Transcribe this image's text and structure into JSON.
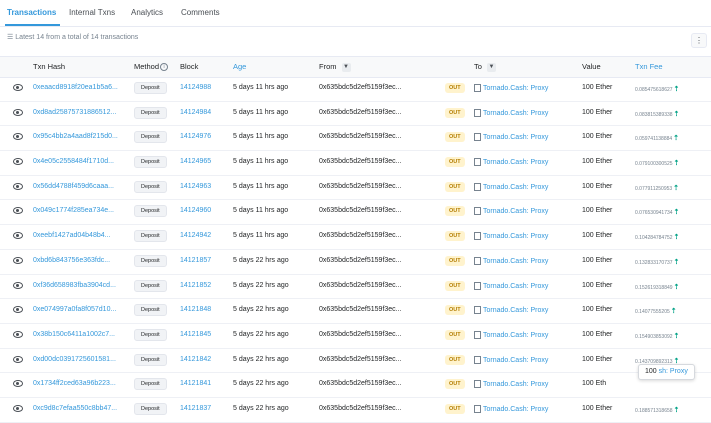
{
  "tabs": [
    {
      "label": "Transactions"
    },
    {
      "label": "Internal Txns"
    },
    {
      "label": "Analytics"
    },
    {
      "label": "Comments"
    }
  ],
  "summary": "Latest 14 from a total of 14 transactions",
  "menu_icon": "⋮",
  "columns": {
    "txn_hash": "Txn Hash",
    "method": "Method",
    "block": "Block",
    "age": "Age",
    "from": "From",
    "to": "To",
    "value": "Value",
    "txn_fee": "Txn Fee"
  },
  "colors": {
    "accent": "#3498db",
    "out_badge_bg": "#fff3cd",
    "out_badge_text": "#b47d00",
    "fee_up": "#00a186"
  },
  "rows": [
    {
      "hash": "0xeaacd8918f20ea1b5a6...",
      "method": "Deposit",
      "block": "14124988",
      "age": "5 days 11 hrs ago",
      "from": "0x635bdc5d2ef5159f3ec...",
      "dir": "OUT",
      "to": "Tornado.Cash: Proxy",
      "value": "100 Ether",
      "fee": "0.085475618627"
    },
    {
      "hash": "0xd8ad25875731886512...",
      "method": "Deposit",
      "block": "14124984",
      "age": "5 days 11 hrs ago",
      "from": "0x635bdc5d2ef5159f3ec...",
      "dir": "OUT",
      "to": "Tornado.Cash: Proxy",
      "value": "100 Ether",
      "fee": "0.083815389338"
    },
    {
      "hash": "0x95c4bb2a4aad8f215d0...",
      "method": "Deposit",
      "block": "14124976",
      "age": "5 days 11 hrs ago",
      "from": "0x635bdc5d2ef5159f3ec...",
      "dir": "OUT",
      "to": "Tornado.Cash: Proxy",
      "value": "100 Ether",
      "fee": "0.059741138884"
    },
    {
      "hash": "0x4e05c2558484f1710d...",
      "method": "Deposit",
      "block": "14124965",
      "age": "5 days 11 hrs ago",
      "from": "0x635bdc5d2ef5159f3ec...",
      "dir": "OUT",
      "to": "Tornado.Cash: Proxy",
      "value": "100 Ether",
      "fee": "0.079100300525"
    },
    {
      "hash": "0x56dd4788f459d6caaa...",
      "method": "Deposit",
      "block": "14124963",
      "age": "5 days 11 hrs ago",
      "from": "0x635bdc5d2ef5159f3ec...",
      "dir": "OUT",
      "to": "Tornado.Cash: Proxy",
      "value": "100 Ether",
      "fee": "0.077911250953"
    },
    {
      "hash": "0x049c1774f285ea734e...",
      "method": "Deposit",
      "block": "14124960",
      "age": "5 days 11 hrs ago",
      "from": "0x635bdc5d2ef5159f3ec...",
      "dir": "OUT",
      "to": "Tornado.Cash: Proxy",
      "value": "100 Ether",
      "fee": "0.076530941734"
    },
    {
      "hash": "0xeebf1427ad04b48b4...",
      "method": "Deposit",
      "block": "14124942",
      "age": "5 days 11 hrs ago",
      "from": "0x635bdc5d2ef5159f3ec...",
      "dir": "OUT",
      "to": "Tornado.Cash: Proxy",
      "value": "100 Ether",
      "fee": "0.104284784752"
    },
    {
      "hash": "0xbd6b843756e363fdc...",
      "method": "Deposit",
      "block": "14121857",
      "age": "5 days 22 hrs ago",
      "from": "0x635bdc5d2ef5159f3ec...",
      "dir": "OUT",
      "to": "Tornado.Cash: Proxy",
      "value": "100 Ether",
      "fee": "0.132833170737"
    },
    {
      "hash": "0xf36d658983fba3904cd...",
      "method": "Deposit",
      "block": "14121852",
      "age": "5 days 22 hrs ago",
      "from": "0x635bdc5d2ef5159f3ec...",
      "dir": "OUT",
      "to": "Tornado.Cash: Proxy",
      "value": "100 Ether",
      "fee": "0.152619318849"
    },
    {
      "hash": "0xe074997a0fa8f057d10...",
      "method": "Deposit",
      "block": "14121848",
      "age": "5 days 22 hrs ago",
      "from": "0x635bdc5d2ef5159f3ec...",
      "dir": "OUT",
      "to": "Tornado.Cash: Proxy",
      "value": "100 Ether",
      "fee": "0.14077555205"
    },
    {
      "hash": "0x38b150c6411a1002c7...",
      "method": "Deposit",
      "block": "14121845",
      "age": "5 days 22 hrs ago",
      "from": "0x635bdc5d2ef5159f3ec...",
      "dir": "OUT",
      "to": "Tornado.Cash: Proxy",
      "value": "100 Ether",
      "fee": "0.154903853092"
    },
    {
      "hash": "0xd00dc0391725601581...",
      "method": "Deposit",
      "block": "14121842",
      "age": "5 days 22 hrs ago",
      "from": "0x635bdc5d2ef5159f3ec...",
      "dir": "OUT",
      "to": "Tornado.Cash: Proxy",
      "value": "100 Ether",
      "fee": "0.143709892313"
    },
    {
      "hash": "0x1734ff2ced63a96b223...",
      "method": "Deposit",
      "block": "14121841",
      "age": "5 days 22 hrs ago",
      "from": "0x635bdc5d2ef5159f3ec...",
      "dir": "OUT",
      "to": "Tornado.Cash: Proxy",
      "value": "100 Eth",
      "fee": ""
    },
    {
      "hash": "0xc9d8c7efaa550c8bb47...",
      "method": "Deposit",
      "block": "14121837",
      "age": "5 days 22 hrs ago",
      "from": "0x635bdc5d2ef5159f3ec...",
      "dir": "OUT",
      "to": "Tornado.Cash: Proxy",
      "value": "100 Ether",
      "fee": "0.188571318658"
    }
  ],
  "tooltip": {
    "prefix": "100",
    "suffix": "sh: Proxy"
  }
}
